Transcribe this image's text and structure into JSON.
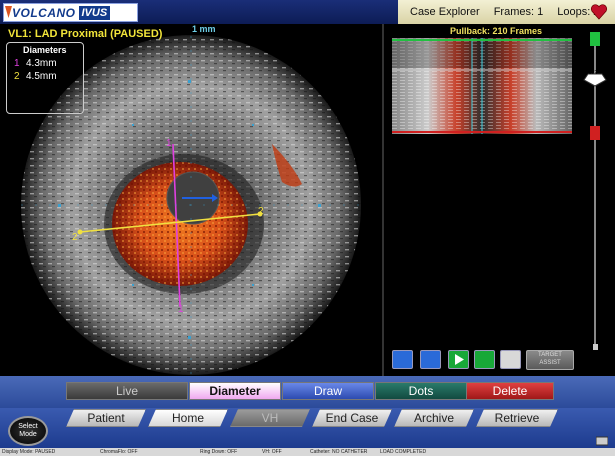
{
  "app": {
    "brand_main": "VOLCANO",
    "brand_sub": "IVUS",
    "case_explorer": "Case Explorer",
    "frames": "Frames: 1",
    "loops": "Loops: 2"
  },
  "image": {
    "title": "VL1: LAD Proximal (PAUSED)",
    "scale_label": "1 mm",
    "diameters_header": "Diameters",
    "diameters": [
      {
        "index": "1",
        "value": "4.3mm",
        "color": "#e040e0"
      },
      {
        "index": "2",
        "value": "4.5mm",
        "color": "#f0e040"
      }
    ],
    "caliper_labels": [
      "1",
      "2",
      "2",
      "1"
    ]
  },
  "pullback": {
    "title": "Pullback: 210 Frames",
    "marker": "0072",
    "target_assist": "TARGET ASSIST"
  },
  "modes": {
    "live": "Live",
    "diameter": "Diameter",
    "draw": "Draw",
    "dots": "Dots",
    "delete": "Delete"
  },
  "nav": {
    "patient": "Patient",
    "home": "Home",
    "vh": "VH",
    "end_case": "End Case",
    "archive": "Archive",
    "retrieve": "Retrieve",
    "select_mode": "Select Mode"
  },
  "status": {
    "display_mode": "Display Mode: PAUSED",
    "chromaflo": "ChromaFlo: OFF",
    "ring_down": "Ring Down: OFF",
    "vh": "VH: OFF",
    "catheter": "Catheter: NO CATHETER",
    "load": "LOAD COMPLETED"
  },
  "colors": {
    "accent_blue": "#2c4b9a",
    "flow_red": "#d84a10",
    "caliper_magenta": "#e040e0",
    "caliper_yellow": "#f0e040"
  }
}
